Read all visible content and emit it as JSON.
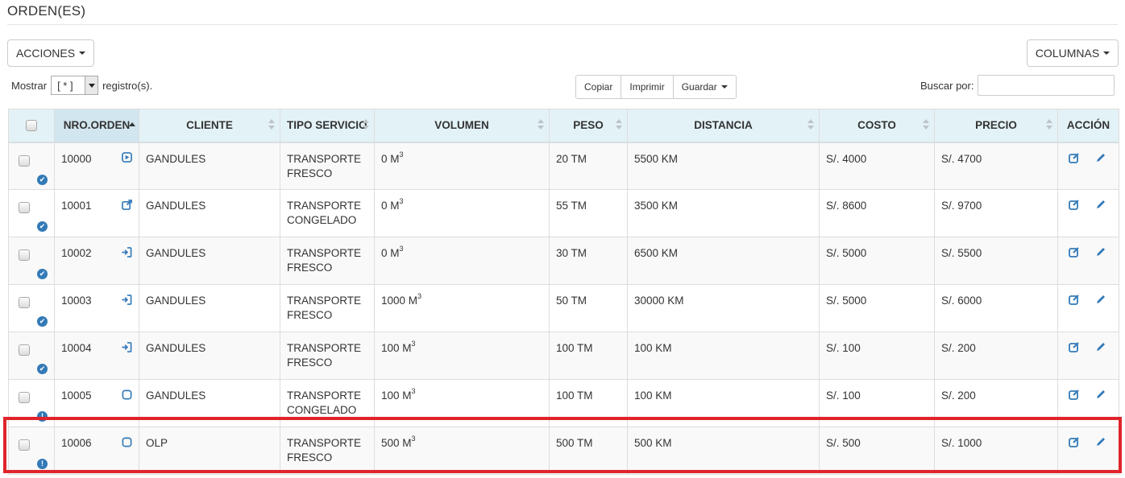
{
  "page": {
    "title": "ORDEN(ES)"
  },
  "toolbar": {
    "acciones_label": "ACCIONES",
    "columnas_label": "COLUMNAS",
    "show_prefix": "Mostrar",
    "show_value": "[ * ]",
    "show_suffix": "registro(s).",
    "copiar_label": "Copiar",
    "imprimir_label": "Imprimir",
    "guardar_label": "Guardar",
    "search_label": "Buscar por:",
    "search_value": ""
  },
  "table": {
    "columns": [
      "NRO.ORDEN",
      "CLIENTE",
      "TIPO SERVICIO",
      "VOLUMEN",
      "PESO",
      "DISTANCIA",
      "COSTO",
      "PRECIO",
      "ACCIÓN"
    ],
    "rows": [
      {
        "nro": "10000",
        "order_icon": "play-circle-icon",
        "status": "check",
        "cliente": "GANDULES",
        "tipo_1": "TRANSPORTE",
        "tipo_2": "FRESCO",
        "volumen": "0 M",
        "volumen_sup": "3",
        "peso": "20 TM",
        "distancia": "5500 KM",
        "costo": "S/. 4000",
        "precio": "S/. 4700"
      },
      {
        "nro": "10001",
        "order_icon": "external-link-icon",
        "status": "check",
        "cliente": "GANDULES",
        "tipo_1": "TRANSPORTE",
        "tipo_2": "CONGELADO",
        "volumen": "0 M",
        "volumen_sup": "3",
        "peso": "55 TM",
        "distancia": "3500 KM",
        "costo": "S/. 8600",
        "precio": "S/. 9700"
      },
      {
        "nro": "10002",
        "order_icon": "sign-in-icon",
        "status": "check",
        "cliente": "GANDULES",
        "tipo_1": "TRANSPORTE",
        "tipo_2": "FRESCO",
        "volumen": "0 M",
        "volumen_sup": "3",
        "peso": "30 TM",
        "distancia": "6500 KM",
        "costo": "S/. 5000",
        "precio": "S/. 5500"
      },
      {
        "nro": "10003",
        "order_icon": "sign-in-icon",
        "status": "check",
        "cliente": "GANDULES",
        "tipo_1": "TRANSPORTE",
        "tipo_2": "FRESCO",
        "volumen": "1000 M",
        "volumen_sup": "3",
        "peso": "50 TM",
        "distancia": "30000 KM",
        "costo": "S/. 5000",
        "precio": "S/. 6000"
      },
      {
        "nro": "10004",
        "order_icon": "sign-in-icon",
        "status": "check",
        "cliente": "GANDULES",
        "tipo_1": "TRANSPORTE",
        "tipo_2": "FRESCO",
        "volumen": "100 M",
        "volumen_sup": "3",
        "peso": "100 TM",
        "distancia": "100 KM",
        "costo": "S/. 100",
        "precio": "S/. 200"
      },
      {
        "nro": "10005",
        "order_icon": "square-icon",
        "status": "exclamation",
        "cliente": "GANDULES",
        "tipo_1": "TRANSPORTE",
        "tipo_2": "CONGELADO",
        "volumen": "100 M",
        "volumen_sup": "3",
        "peso": "100 TM",
        "distancia": "100 KM",
        "costo": "S/. 100",
        "precio": "S/. 200"
      },
      {
        "nro": "10006",
        "order_icon": "square-icon",
        "status": "exclamation",
        "cliente": "OLP",
        "tipo_1": "TRANSPORTE",
        "tipo_2": "FRESCO",
        "volumen": "500 M",
        "volumen_sup": "3",
        "peso": "500 TM",
        "distancia": "500 KM",
        "costo": "S/. 500",
        "precio": "S/. 1000"
      }
    ]
  },
  "colors": {
    "accent": "#337ab7",
    "header_bg": "#e3f2f7",
    "highlight": "#e0242b"
  }
}
